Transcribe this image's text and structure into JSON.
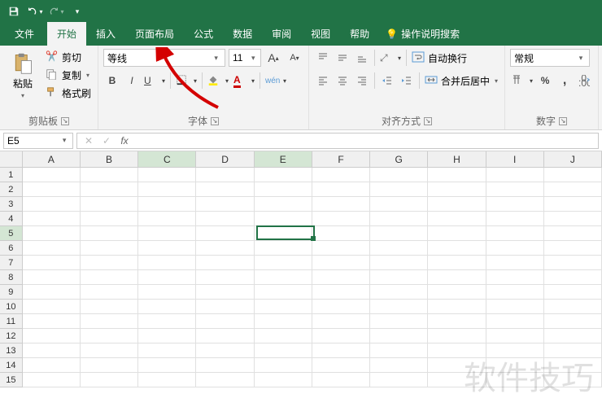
{
  "qat": {
    "save_icon": "save",
    "undo_icon": "undo",
    "redo_icon": "redo"
  },
  "tabs": {
    "file": "文件",
    "home": "开始",
    "insert": "插入",
    "page_layout": "页面布局",
    "formulas": "公式",
    "data": "数据",
    "review": "审阅",
    "view": "视图",
    "help": "帮助",
    "search": "操作说明搜索"
  },
  "clipboard": {
    "paste_label": "粘贴",
    "cut": "剪切",
    "copy": "复制",
    "format_painter": "格式刷",
    "group_label": "剪贴板"
  },
  "font": {
    "name": "等线",
    "size": "11",
    "increase": "A",
    "decrease": "A",
    "bold": "B",
    "italic": "I",
    "underline": "U",
    "phonetic": "wén",
    "group_label": "字体"
  },
  "alignment": {
    "wrap": "自动换行",
    "merge": "合并后居中",
    "group_label": "对齐方式"
  },
  "number": {
    "format": "常规",
    "percent": "%",
    "comma": ",",
    "group_label": "数字"
  },
  "namebox": {
    "value": "E5"
  },
  "formula_bar": {
    "fx": "fx"
  },
  "columns": [
    "A",
    "B",
    "C",
    "D",
    "E",
    "F",
    "G",
    "H",
    "I",
    "J"
  ],
  "rows": [
    "1",
    "2",
    "3",
    "4",
    "5",
    "6",
    "7",
    "8",
    "9",
    "10",
    "11",
    "12",
    "13",
    "14",
    "15"
  ],
  "selected": {
    "col_index": 4,
    "row_index": 4
  },
  "highlighted_header_col_index": 2,
  "watermark": "软件技巧"
}
